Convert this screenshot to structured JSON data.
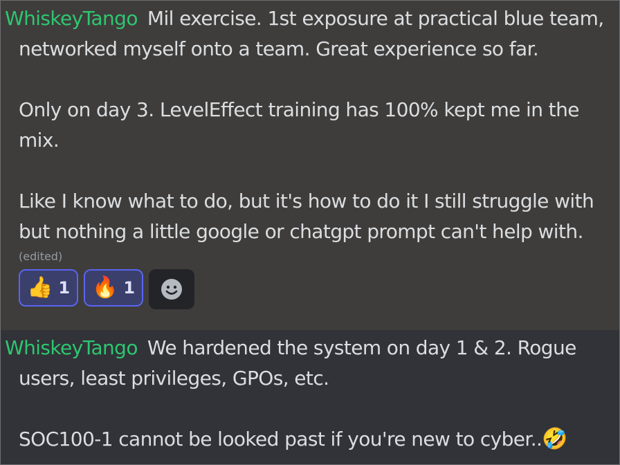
{
  "messages": [
    {
      "author": "WhiskeyTango",
      "lines": [
        "Mil exercise. 1st exposure at practical blue team,",
        "networked myself onto a team. Great experience so far.",
        "Only on day 3. LevelEffect training has 100% kept me in the",
        "mix.",
        "Like I know what to do, but it's how to do it I still struggle with",
        "but nothing a little google or chatgpt prompt can't help with."
      ],
      "edited": "(edited)",
      "reactions": [
        {
          "emoji": "👍",
          "emoji_name": "thumbs-up",
          "count": "1"
        },
        {
          "emoji": "🔥",
          "emoji_name": "fire",
          "count": "1"
        }
      ],
      "add_reaction_icon": "smiley-add-reaction-icon"
    },
    {
      "author": "WhiskeyTango",
      "lines": [
        "We hardened the system on day 1 & 2. Rogue",
        "users, least privileges, GPOs, etc.",
        "SOC100-1 cannot be looked past if you're new to cyber.."
      ],
      "trailing_emoji": "🤣",
      "trailing_emoji_name": "rolling-on-floor-laughing"
    }
  ],
  "colors": {
    "author": "#2dc770",
    "text": "#dbdee1",
    "highlight_bg": "#3f3d3b",
    "chat_bg": "#313338",
    "reaction_border": "#5865f2"
  }
}
